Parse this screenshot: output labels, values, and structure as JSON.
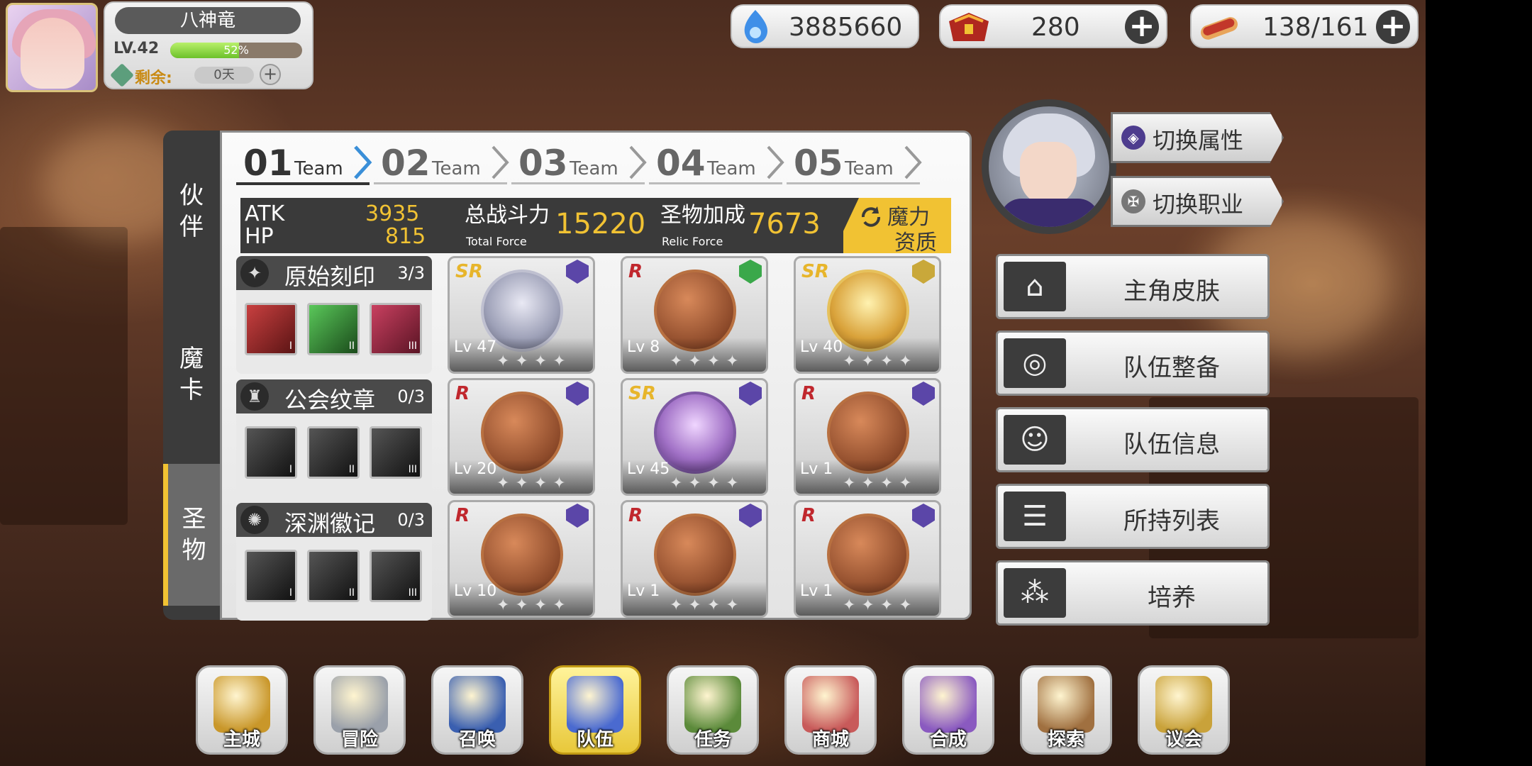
{
  "player": {
    "name": "八神竜",
    "level": "LV.42",
    "xp_percent": 52,
    "xp_text": "52%",
    "remain_label": "剩余:",
    "remain_value": "0天",
    "plus": "+"
  },
  "currencies": {
    "crystal": "3885660",
    "stamina_item": "280",
    "food": "138/161"
  },
  "side_tabs": [
    {
      "label": "伙\n伴",
      "active": false
    },
    {
      "label": "魔\n卡",
      "active": false
    },
    {
      "label": "圣\n物",
      "active": true
    }
  ],
  "team_tabs": [
    {
      "num": "01",
      "word": "Team",
      "active": true
    },
    {
      "num": "02",
      "word": "Team",
      "active": false
    },
    {
      "num": "03",
      "word": "Team",
      "active": false
    },
    {
      "num": "04",
      "word": "Team",
      "active": false
    },
    {
      "num": "05",
      "word": "Team",
      "active": false
    }
  ],
  "stats": {
    "atk_label": "ATK",
    "atk_value": "3935",
    "hp_label": "HP",
    "hp_value": "815",
    "total_label": "总战斗力",
    "total_sub": "Total Force",
    "total_value": "15220",
    "relic_label": "圣物加成",
    "relic_sub": "Relic Force",
    "relic_value": "7673",
    "magic_btn_l1": "魔力",
    "magic_btn_l2": "资质"
  },
  "categories": [
    {
      "name": "原始刻印",
      "count": "3/3",
      "icon": "primal-seal-icon",
      "slots": [
        "I",
        "II",
        "III"
      ],
      "colors": [
        "#8a2a2a",
        "#2f7a2f",
        "#8a2a3a"
      ]
    },
    {
      "name": "公会纹章",
      "count": "0/3",
      "icon": "guild-crest-icon",
      "slots": [
        "I",
        "II",
        "III"
      ],
      "colors": [
        "#2a2a2a",
        "#2a2a2a",
        "#2a2a2a"
      ]
    },
    {
      "name": "深渊徽记",
      "count": "0/3",
      "icon": "abyss-mark-icon",
      "slots": [
        "I",
        "II",
        "III"
      ],
      "colors": [
        "#2a2a2a",
        "#2a2a2a",
        "#2a2a2a"
      ]
    }
  ],
  "relics": [
    {
      "rarity": "SR",
      "level": "Lv 47",
      "style": "silver",
      "badge": "#5b46a8"
    },
    {
      "rarity": "R",
      "level": "Lv 8",
      "style": "bronze",
      "badge": "#3aa84a"
    },
    {
      "rarity": "SR",
      "level": "Lv 40",
      "style": "gold",
      "badge": "#c9a83a"
    },
    {
      "rarity": "R",
      "level": "Lv 20",
      "style": "bronze",
      "badge": "#5b46a8"
    },
    {
      "rarity": "SR",
      "level": "Lv 45",
      "style": "purple",
      "badge": "#5b46a8"
    },
    {
      "rarity": "R",
      "level": "Lv 1",
      "style": "bronze",
      "badge": "#5b46a8"
    },
    {
      "rarity": "R",
      "level": "Lv 10",
      "style": "bronze",
      "badge": "#5b46a8"
    },
    {
      "rarity": "R",
      "level": "Lv 1",
      "style": "bronze",
      "badge": "#5b46a8"
    },
    {
      "rarity": "R",
      "level": "Lv 1",
      "style": "bronze",
      "badge": "#5b46a8"
    }
  ],
  "right": {
    "switch_attr": "切换属性",
    "switch_job": "切换职业",
    "menu": [
      {
        "label": "主角皮肤",
        "icon": "hanger-icon"
      },
      {
        "label": "队伍整备",
        "icon": "swirl-icon"
      },
      {
        "label": "队伍信息",
        "icon": "team-info-icon"
      },
      {
        "label": "所持列表",
        "icon": "list-icon"
      },
      {
        "label": "培养",
        "icon": "training-icon"
      }
    ]
  },
  "nav": [
    {
      "label": "主城",
      "icon": "crown-icon",
      "active": false
    },
    {
      "label": "冒险",
      "icon": "sword-shield-icon",
      "active": false
    },
    {
      "label": "召唤",
      "icon": "summon-card-icon",
      "active": false
    },
    {
      "label": "队伍",
      "icon": "winged-crest-icon",
      "active": true
    },
    {
      "label": "任务",
      "icon": "book-icon",
      "active": false
    },
    {
      "label": "商城",
      "icon": "mushroom-shop-icon",
      "active": false
    },
    {
      "label": "合成",
      "icon": "potion-icon",
      "active": false
    },
    {
      "label": "探索",
      "icon": "shovel-icon",
      "active": false
    },
    {
      "label": "议会",
      "icon": "council-icon",
      "active": false
    }
  ],
  "colors": {
    "accent": "#f1c233",
    "dark_panel": "#3a3a3a",
    "rarity_sr": "#e7b52b",
    "rarity_r": "#c0272d"
  }
}
